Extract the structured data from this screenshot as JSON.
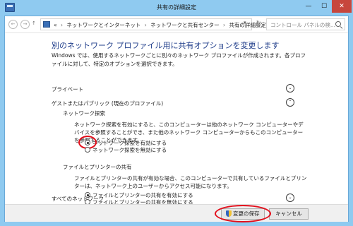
{
  "window": {
    "title": "共有の詳細設定",
    "minimize": "—",
    "maximize": "☐",
    "close": "✕"
  },
  "address_bar": {
    "back": "←",
    "forward": "→",
    "up": "↑",
    "prefix": "«",
    "crumbs": [
      "ネットワークとインターネット",
      "ネットワークと共有センター",
      "共有の詳細設定"
    ],
    "separator": "›",
    "dropdown": "▾",
    "refresh": "↻"
  },
  "search": {
    "placeholder": "コントロール パネルの検..."
  },
  "page": {
    "heading": "別のネットワーク プロファイル用に共有オプションを変更します",
    "description": "Windows では、使用するネットワークごとに別々のネットワーク プロファイルが作成されます。各プロファイルに対して、特定のオプションを選択できます。"
  },
  "sections": {
    "private": {
      "title": "プライベート",
      "expander": "⌄"
    },
    "guest": {
      "title": "ゲストまたはパブリック (現在のプロファイル)",
      "expander": "⌃",
      "network_discovery": {
        "title": "ネットワーク探索",
        "hint": "ネットワーク探索を有効にすると、このコンピューターは他のネットワーク コンピューターやデバイスを参照することができ、また他のネットワーク コンピューターからもこのコンピューターを参照することができます。",
        "options": [
          {
            "label": "ネットワーク探索を有効にする",
            "checked": true
          },
          {
            "label": "ネットワーク探索を無効にする",
            "checked": false
          }
        ]
      },
      "file_printer": {
        "title": "ファイルとプリンターの共有",
        "hint": "ファイルとプリンターの共有が有効な場合、このコンピューターで共有しているファイルとプリンターは、ネットワーク上のユーザーからアクセス可能になります。",
        "options": [
          {
            "label": "ファイルとプリンターの共有を有効にする",
            "checked": true
          },
          {
            "label": "ファイルとプリンターの共有を無効にする",
            "checked": false
          }
        ]
      }
    },
    "all": {
      "title": "すべてのネットワーク",
      "expander": "⌄"
    }
  },
  "footer": {
    "save_label": "変更の保存",
    "cancel_label": "キャンセル"
  },
  "colors": {
    "window_frame": "#8fcaf0",
    "heading": "#1f3d8a",
    "highlight_oval": "#e30e1b",
    "close_button": "#c7463c"
  }
}
